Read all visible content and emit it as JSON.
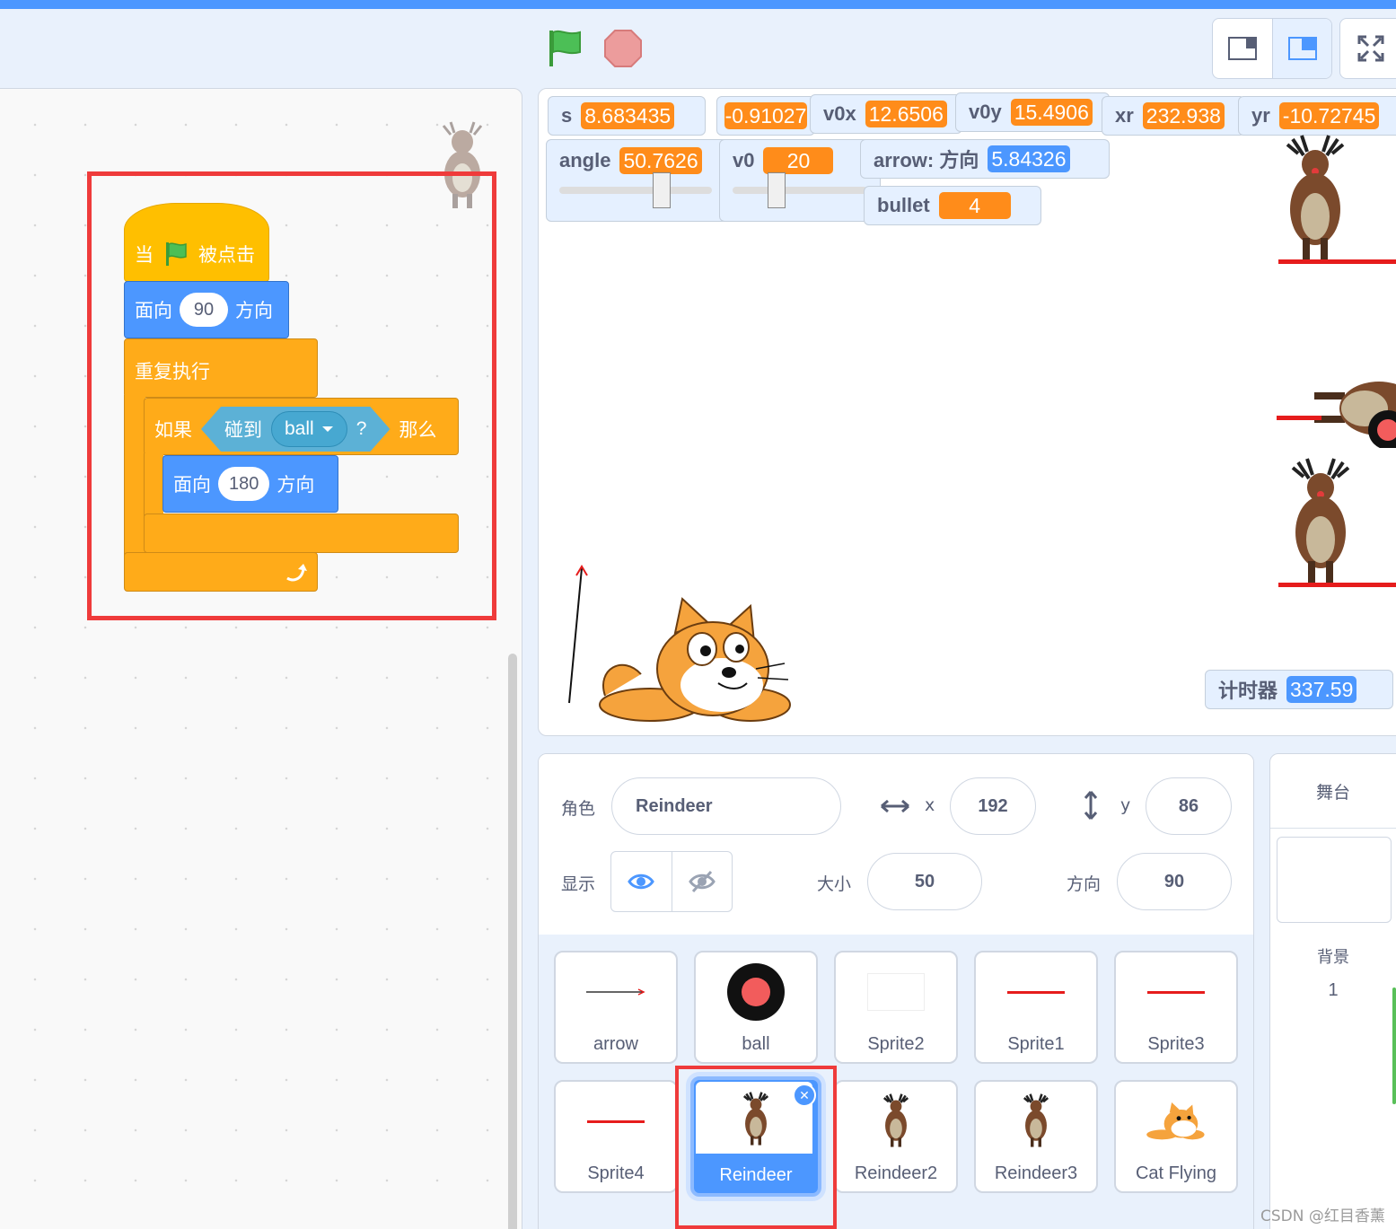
{
  "header": {
    "green_flag": "green-flag-icon",
    "stop": "stop-icon",
    "layout_small": "small-stage-icon",
    "layout_normal": "normal-stage-icon",
    "fullscreen": "fullscreen-icon"
  },
  "code": {
    "hat_when": "当",
    "hat_clicked": "被点击",
    "point1_label": "面向",
    "point1_value": "90",
    "point1_suffix": "方向",
    "forever_label": "重复执行",
    "if_label": "如果",
    "touching_label": "碰到",
    "touching_target": "ball",
    "question_mark": "?",
    "then_label": "那么",
    "point2_label": "面向",
    "point2_value": "180",
    "point2_suffix": "方向"
  },
  "monitors": {
    "s": {
      "label": "s",
      "value": "8.683435"
    },
    "unnamed": {
      "value": "-0.91027"
    },
    "v0x": {
      "label": "v0x",
      "value": "12.6506"
    },
    "v0y": {
      "label": "v0y",
      "value": "15.4906"
    },
    "xr": {
      "label": "xr",
      "value": "232.938"
    },
    "yr": {
      "label": "yr",
      "value": "-10.72745"
    },
    "angle": {
      "label": "angle",
      "value": "50.7626",
      "slider_fraction": 0.69
    },
    "v0": {
      "label": "v0",
      "value": "20",
      "slider_fraction": 0.3
    },
    "arrow_dir": {
      "label": "arrow: 方向",
      "value": "5.84326"
    },
    "bullet": {
      "label": "bullet",
      "value": "4"
    },
    "timer": {
      "label": "计时器",
      "value": "337.59"
    }
  },
  "sprite_info": {
    "sprite_label": "角色",
    "sprite_name": "Reindeer",
    "x_label": "x",
    "x_value": "192",
    "y_label": "y",
    "y_value": "86",
    "show_label": "显示",
    "size_label": "大小",
    "size_value": "50",
    "direction_label": "方向",
    "direction_value": "90"
  },
  "sprites": [
    {
      "name": "arrow"
    },
    {
      "name": "ball"
    },
    {
      "name": "Sprite2"
    },
    {
      "name": "Sprite1"
    },
    {
      "name": "Sprite3"
    },
    {
      "name": "Sprite4"
    },
    {
      "name": "Reindeer",
      "selected": true
    },
    {
      "name": "Reindeer2"
    },
    {
      "name": "Reindeer3"
    },
    {
      "name": "Cat Flying"
    }
  ],
  "stage_panel": {
    "title": "舞台",
    "backdrop_label": "背景",
    "backdrop_count": "1"
  },
  "watermark": "CSDN @红目香薰",
  "colors": {
    "motion": "#4c97ff",
    "control": "#ffab19",
    "events": "#ffbf00",
    "sensing": "#5cb1d6",
    "monitor_value": "#ff8c1a",
    "highlight": "#ef3b3b"
  }
}
